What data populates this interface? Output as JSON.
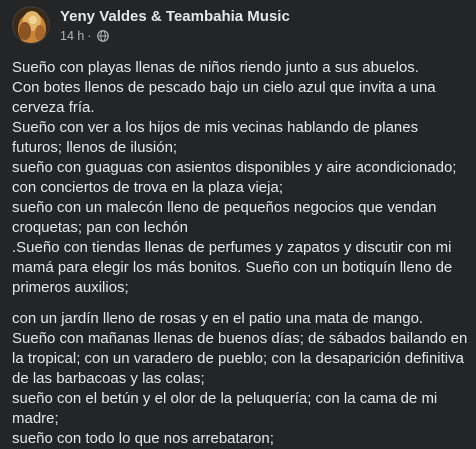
{
  "post": {
    "author": "Yeny Valdes & Teambahia Music",
    "time": "14 h",
    "separator": "·",
    "privacy_icon": "globe-icon",
    "paragraphs": [
      [
        "Sueño con playas llenas de niños riendo junto a sus abuelos.",
        "Con botes llenos de pescado bajo un cielo azul que invita a una cerveza fría.",
        "Sueño con ver a los hijos de mis vecinas hablando de planes futuros; llenos de ilusión;",
        "sueño con guaguas con asientos disponibles y aire acondicionado;",
        "con conciertos de trova en la plaza vieja;",
        "sueño con un malecón lleno de pequeños negocios que vendan croquetas; pan con lechón",
        ".Sueño con tiendas llenas de perfumes y zapatos y discutir con mi mamá para elegir los más bonitos. Sueño con un botiquín lleno de primeros auxilios;"
      ],
      [
        "con un jardín lleno de rosas y en el patio una mata de mango.",
        "Sueño con mañanas llenas de buenos días; de sábados bailando en la tropical; con un varadero de pueblo; con la desaparición definitiva de las barbacoas y las colas;",
        "sueño con el betún y el olor de la peluquería; con la cama de mi madre;",
        "sueño con todo lo que nos arrebataron;"
      ]
    ]
  },
  "colors": {
    "background": "#242526",
    "text": "#e4e6eb",
    "secondary_text": "#b0b3b8"
  }
}
